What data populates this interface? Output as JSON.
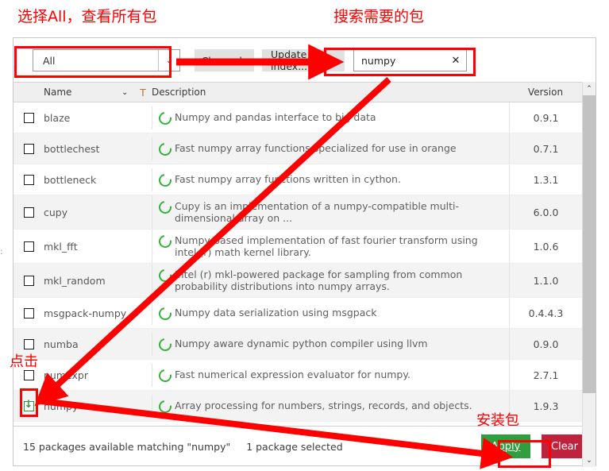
{
  "annotations": [
    {
      "text": "选择All，查看所有包",
      "name": "annotation-select-all"
    },
    {
      "text": "搜索需要的包",
      "name": "annotation-search-package"
    },
    {
      "text": "点击",
      "name": "annotation-click"
    },
    {
      "text": "安装包",
      "name": "annotation-install-package"
    }
  ],
  "toolbar": {
    "filter_value": "All",
    "filter_arrow": "⌄",
    "channels_label": "Channels",
    "update_index_label": "Update index...",
    "search_value": "numpy",
    "search_clear": "✕"
  },
  "table": {
    "headers": {
      "name": "Name",
      "sort_icon": "⌄",
      "filter_icon": "T",
      "description": "Description",
      "version": "Version"
    },
    "rows": [
      {
        "name": "blaze",
        "description": "Numpy and pandas interface to big data",
        "version": "0.9.1",
        "selected": false
      },
      {
        "name": "bottlechest",
        "description": "Fast numpy array functions specialized for use in orange",
        "version": "0.7.1",
        "selected": false
      },
      {
        "name": "bottleneck",
        "description": "Fast numpy array functions written in cython.",
        "version": "1.3.1",
        "selected": false
      },
      {
        "name": "cupy",
        "description": "Cupy is an implementation of a numpy-compatible multi-dimensional array on ...",
        "version": "6.0.0",
        "selected": false
      },
      {
        "name": "mkl_fft",
        "description": "Numpy-based implementation of fast fourier transform using intel (r) math kernel library.",
        "version": "1.0.6",
        "selected": false
      },
      {
        "name": "mkl_random",
        "description": "Intel (r) mkl-powered package for sampling from common probability distributions into numpy arrays.",
        "version": "1.1.0",
        "selected": false
      },
      {
        "name": "msgpack-numpy",
        "description": "Numpy data serialization using msgpack",
        "version": "0.4.4.3",
        "selected": false
      },
      {
        "name": "numba",
        "description": "Numpy aware dynamic python compiler using llvm",
        "version": "0.9.0",
        "selected": false
      },
      {
        "name": "numexpr",
        "description": "Fast numerical expression evaluator for numpy.",
        "version": "2.7.1",
        "selected": false
      },
      {
        "name": "numpy",
        "description": "Array processing for numbers, strings, records, and objects.",
        "version": "1.9.3",
        "selected": true
      },
      {
        "name": "",
        "description": "",
        "version": "",
        "selected": false
      }
    ]
  },
  "scrollbar": {
    "up_arrow": "⌃",
    "down_arrow": "⌄"
  },
  "statusbar": {
    "available_text": "15 packages available matching \"numpy\"",
    "selected_text": "1 package selected",
    "apply_label": "Apply",
    "clear_label": "Clear"
  },
  "colors": {
    "apply_green": "#2f9e3f",
    "clear_red": "#c0213c",
    "annotation_red": "#ff0000",
    "package_icon_green": "#35b13a"
  }
}
